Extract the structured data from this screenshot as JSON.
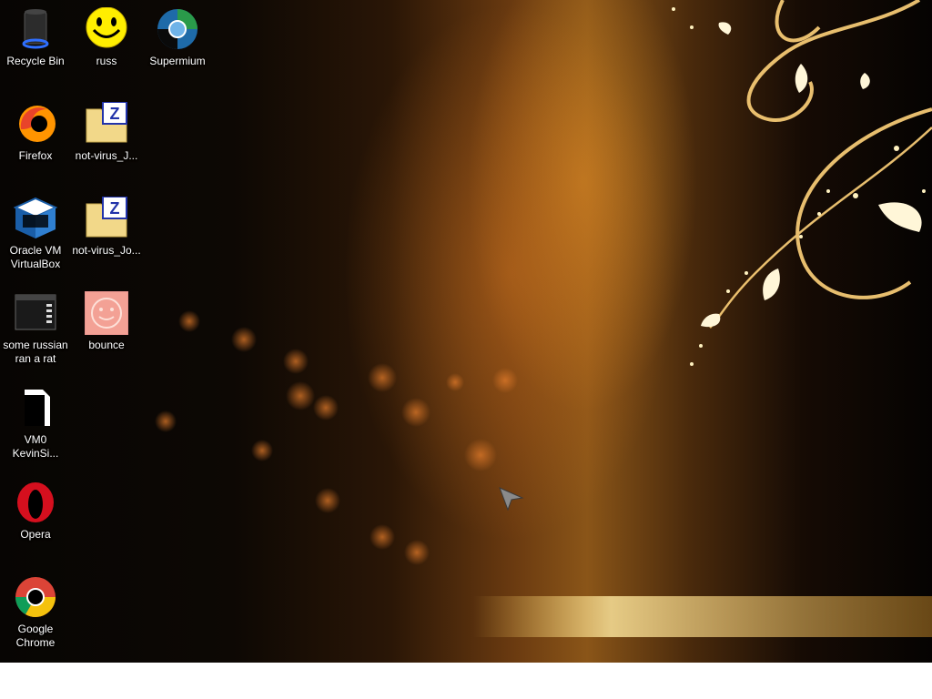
{
  "desktop": {
    "icons": [
      {
        "label": "Recycle Bin",
        "icon": "recycle-bin-icon"
      },
      {
        "label": "russ",
        "icon": "smiley-icon"
      },
      {
        "label": "Supermium",
        "icon": "supermium-icon"
      },
      {
        "label": "Firefox",
        "icon": "firefox-icon"
      },
      {
        "label": "not-virus_J...",
        "icon": "zip-folder-icon"
      },
      {
        "label": "Oracle VM\nVirtualBox",
        "icon": "virtualbox-icon"
      },
      {
        "label": "not-virus_Jo...",
        "icon": "zip-folder-icon"
      },
      {
        "label": "some russian\nran a rat",
        "icon": "executable-icon"
      },
      {
        "label": "bounce",
        "icon": "bounce-smiley-icon"
      },
      {
        "label": "VM0\nKevinSi...",
        "icon": "document-icon"
      },
      {
        "label": "Opera",
        "icon": "opera-icon"
      },
      {
        "label": "Google\nChrome",
        "icon": "chrome-icon"
      }
    ]
  }
}
